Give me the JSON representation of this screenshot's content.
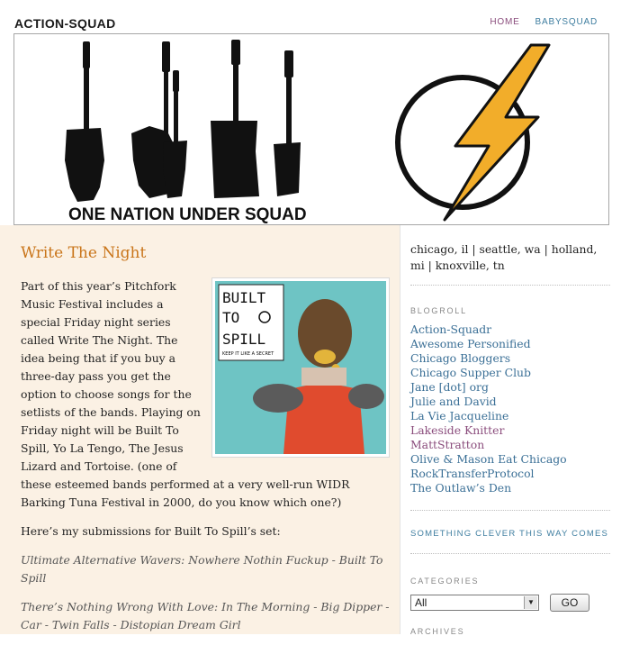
{
  "site": {
    "title": "ACTION-SQUAD"
  },
  "nav": {
    "home": "HOME",
    "babysquad": "BABYSQUAD"
  },
  "banner": {
    "slogan": "ONE NATION UNDER SQUAD"
  },
  "post": {
    "title": "Write The Night",
    "intro": "Part of this year’s Pitchfork Music Festival includes a special Friday night series called Write The Night. The idea being that if you buy a three-day pass you get the option to choose songs for the setlists of the bands. Playing on Friday night will be Built To Spill, Yo La Tengo, The Jesus Lizard and Tortoise. (one of these esteemed bands performed at a very well-run WIDR Barking Tuna Festival in 2000, do you know which one?)",
    "submissions_intro": "Here’s my submissions for Built To Spill’s set:",
    "songs": [
      "Ultimate Alternative Wavers: Nowhere Nothin Fuckup - Built To Spill",
      "There’s Nothing Wrong With Love: In The Morning - Big Dipper - Car - Twin Falls - Distopian Dream Girl"
    ],
    "album": {
      "line1": "BUILT",
      "line2": "TO",
      "line3": "SPILL",
      "tagline": "KEEP IT LIKE A SECRET"
    }
  },
  "sidebar": {
    "cities": "chicago, il | seattle, wa | holland, mi | knoxville, tn",
    "blogroll_heading": "BLOGROLL",
    "blogroll": [
      "Action-Squadr",
      "Awesome Personified",
      "Chicago Bloggers",
      "Chicago Supper Club",
      "Jane [dot] org",
      "Julie and David",
      "La Vie Jacqueline",
      "Lakeside Knitter",
      "MattStratton",
      "Olive & Mason Eat Chicago",
      "RockTransferProtocol",
      "The Outlaw’s Den"
    ],
    "clever_link": "SOMETHING CLEVER THIS WAY COMES",
    "categories_heading": "CATEGORIES",
    "categories_selected": "All",
    "go_label": "GO",
    "archives_heading": "ARCHIVES"
  },
  "colors": {
    "accent_title": "#c9751a",
    "link": "#3a6f96",
    "visited_link": "#8a4c7c",
    "bolt": "#f2ad2a",
    "content_bg": "#fbf1e4"
  },
  "icons": [
    "guitar-michigan-icon",
    "lightning-bolt-icon",
    "select-arrow-icon"
  ]
}
